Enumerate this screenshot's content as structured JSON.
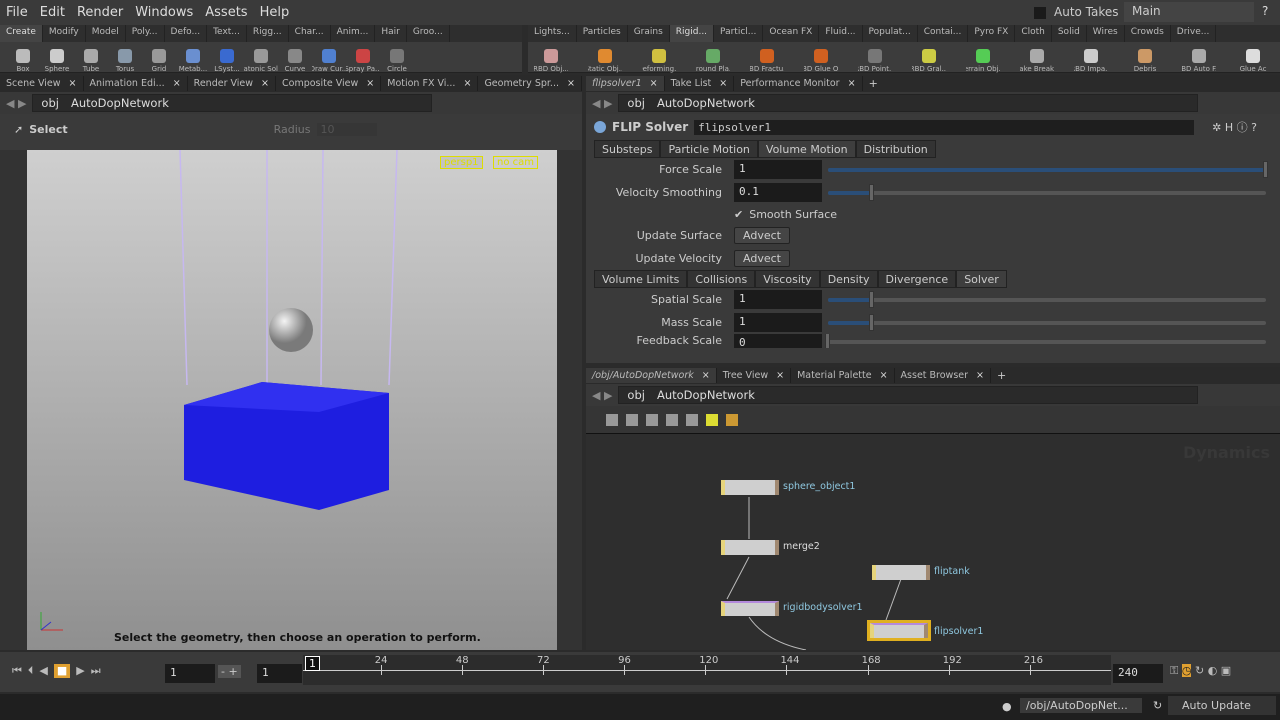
{
  "menubar": {
    "items": [
      "File",
      "Edit",
      "Render",
      "Windows",
      "Assets",
      "Help"
    ],
    "auto_takes": "Auto Takes",
    "take": "Main"
  },
  "shelf_left": {
    "tabs": [
      "Create",
      "Modify",
      "Model",
      "Poly...",
      "Defo...",
      "Text...",
      "Rigg...",
      "Char...",
      "Anim...",
      "Hair",
      "Groo..."
    ],
    "tools": [
      "Box",
      "Sphere",
      "Tube",
      "Torus",
      "Grid",
      "Metab...",
      "LSyst...",
      "Platonic Sol...",
      "Curve",
      "Draw Cur...",
      "Spray Pa...",
      "Circle"
    ]
  },
  "shelf_right": {
    "tabs": [
      "Lights...",
      "Particles",
      "Grains",
      "Rigid...",
      "Particl...",
      "Ocean FX",
      "Fluid...",
      "Populat...",
      "Contai...",
      "Pyro FX",
      "Cloth",
      "Solid",
      "Wires",
      "Crowds",
      "Drive..."
    ],
    "tools": [
      "RBD Obj...",
      "Static Obj...",
      "Deforming...",
      "Ground Pla...",
      "RBD Fractu...",
      "RBD Glue O...",
      "RBD Point...",
      "RBD Gral...",
      "Terrain Obj...",
      "Make Break...",
      "RBD Impa...",
      "Debris",
      "RBD Auto F...",
      "Glue Ac"
    ]
  },
  "scene_pane": {
    "tabs": [
      "Scene View",
      "Animation Edi...",
      "Render View",
      "Composite View",
      "Motion FX Vi...",
      "Geometry Spr..."
    ],
    "path": [
      "obj",
      "AutoDopNetwork"
    ],
    "tool": "Select",
    "radius_label": "Radius",
    "radius_value": "10",
    "camera": "persp1",
    "cam_menu": "no cam",
    "status": "Select the geometry, then choose an operation to perform."
  },
  "param_pane": {
    "tabs": [
      "flipsolver1",
      "Take List",
      "Performance Monitor"
    ],
    "path": [
      "obj",
      "AutoDopNetwork"
    ],
    "node_type": "FLIP Solver",
    "node_name": "flipsolver1",
    "tabs1": [
      "Substeps",
      "Particle Motion",
      "Volume Motion",
      "Distribution"
    ],
    "active_tab1": "Volume Motion",
    "force_scale": {
      "label": "Force Scale",
      "value": "1",
      "slider": 1.0
    },
    "velocity_smoothing": {
      "label": "Velocity Smoothing",
      "value": "0.1",
      "slider": 0.1
    },
    "smooth_surface": {
      "label": "Smooth Surface",
      "checked": true
    },
    "update_surface": {
      "label": "Update Surface",
      "value": "Advect"
    },
    "update_velocity": {
      "label": "Update Velocity",
      "value": "Advect"
    },
    "tabs2": [
      "Volume Limits",
      "Collisions",
      "Viscosity",
      "Density",
      "Divergence",
      "Solver"
    ],
    "active_tab2": "Solver",
    "spatial_scale": {
      "label": "Spatial Scale",
      "value": "1",
      "slider": 0.1
    },
    "mass_scale": {
      "label": "Mass Scale",
      "value": "1",
      "slider": 0.1
    },
    "feedback_scale": {
      "label": "Feedback Scale",
      "value": "0",
      "slider": 0
    }
  },
  "network_pane": {
    "tabs": [
      "/obj/AutoDopNetwork",
      "Tree View",
      "Material Palette",
      "Asset Browser"
    ],
    "path": [
      "obj",
      "AutoDopNetwork"
    ],
    "watermark": "Dynamics",
    "nodes": [
      "sphere_object1",
      "merge2",
      "rigidbodysolver1",
      "fliptank",
      "flipsolver1"
    ]
  },
  "timeline": {
    "start": "1",
    "current": "1",
    "end": "240",
    "ticks": [
      "24",
      "48",
      "72",
      "96",
      "120",
      "144",
      "168",
      "192",
      "216"
    ],
    "cursor": "1"
  },
  "statusbar": {
    "path": "/obj/AutoDopNet...",
    "update": "Auto Update"
  }
}
